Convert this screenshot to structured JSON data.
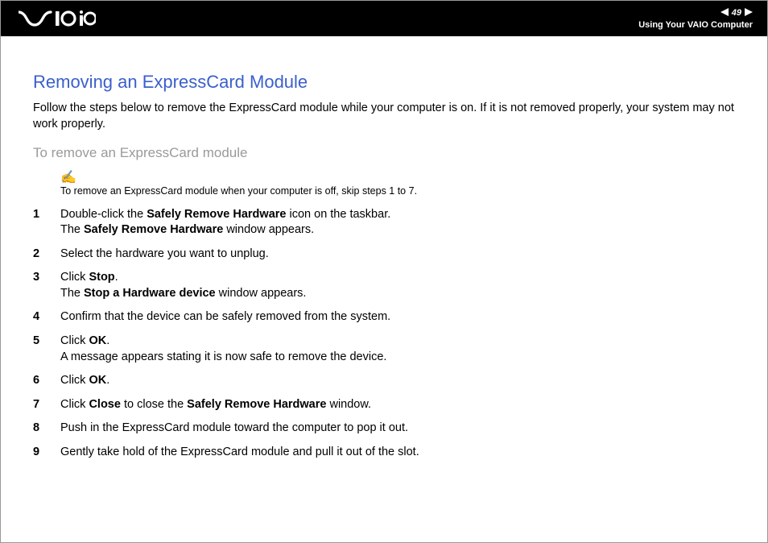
{
  "header": {
    "page_number": "49",
    "section": "Using Your VAIO Computer"
  },
  "content": {
    "title": "Removing an ExpressCard Module",
    "intro": "Follow the steps below to remove the ExpressCard module while your computer is on. If it is not removed properly, your system may not work properly.",
    "subtitle": "To remove an ExpressCard module",
    "note": "To remove an ExpressCard module when your computer is off, skip steps 1 to 7.",
    "steps": [
      {
        "n": "1",
        "pre": "Double-click the ",
        "b1": "Safely Remove Hardware",
        "mid": " icon on the taskbar.\nThe ",
        "b2": "Safely Remove Hardware",
        "post": " window appears."
      },
      {
        "n": "2",
        "text": "Select the hardware you want to unplug."
      },
      {
        "n": "3",
        "pre": "Click ",
        "b1": "Stop",
        "mid": ".\nThe ",
        "b2": "Stop a Hardware device",
        "post": " window appears."
      },
      {
        "n": "4",
        "text": "Confirm that the device can be safely removed from the system."
      },
      {
        "n": "5",
        "pre": "Click ",
        "b1": "OK",
        "mid": ".\nA message appears stating it is now safe to remove the device.",
        "b2": "",
        "post": ""
      },
      {
        "n": "6",
        "pre": "Click ",
        "b1": "OK",
        "mid": ".",
        "b2": "",
        "post": ""
      },
      {
        "n": "7",
        "pre": "Click ",
        "b1": "Close",
        "mid": " to close the ",
        "b2": "Safely Remove Hardware",
        "post": " window."
      },
      {
        "n": "8",
        "text": "Push in the ExpressCard module toward the computer to pop it out."
      },
      {
        "n": "9",
        "text": "Gently take hold of the ExpressCard module and pull it out of the slot."
      }
    ]
  }
}
